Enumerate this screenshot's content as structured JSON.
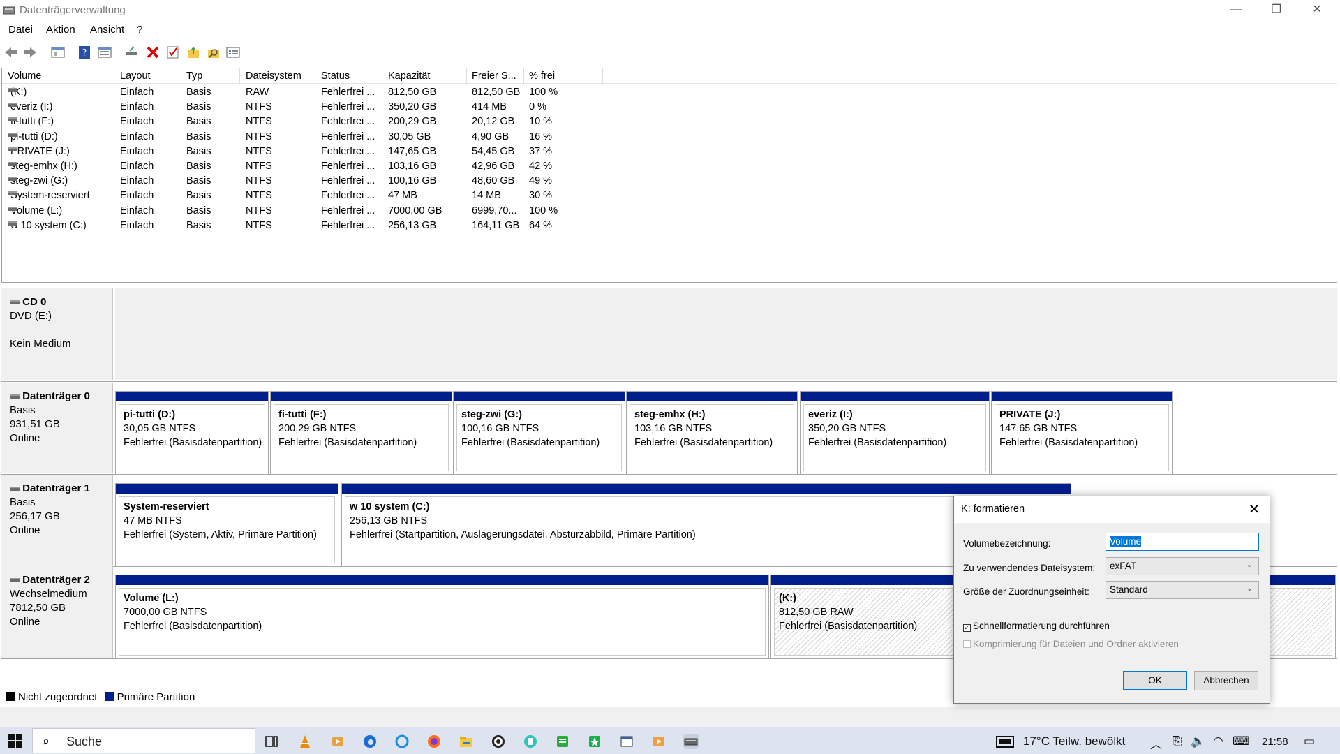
{
  "window": {
    "title": "Datenträgerverwaltung",
    "minimize": "—",
    "maximize": "❐",
    "close": "✕"
  },
  "menu": [
    "Datei",
    "Aktion",
    "Ansicht",
    "?"
  ],
  "volume_table": {
    "columns": [
      "Volume",
      "Layout",
      "Typ",
      "Dateisystem",
      "Status",
      "Kapazität",
      "Freier S...",
      "% frei"
    ],
    "rows": [
      [
        "(K:)",
        "Einfach",
        "Basis",
        "RAW",
        "Fehlerfrei ...",
        "812,50 GB",
        "812,50 GB",
        "100 %"
      ],
      [
        "everiz (I:)",
        "Einfach",
        "Basis",
        "NTFS",
        "Fehlerfrei ...",
        "350,20 GB",
        "414 MB",
        "0 %"
      ],
      [
        "fi-tutti (F:)",
        "Einfach",
        "Basis",
        "NTFS",
        "Fehlerfrei ...",
        "200,29 GB",
        "20,12 GB",
        "10 %"
      ],
      [
        "pi-tutti (D:)",
        "Einfach",
        "Basis",
        "NTFS",
        "Fehlerfrei ...",
        "30,05 GB",
        "4,90 GB",
        "16 %"
      ],
      [
        "PRIVATE (J:)",
        "Einfach",
        "Basis",
        "NTFS",
        "Fehlerfrei ...",
        "147,65 GB",
        "54,45 GB",
        "37 %"
      ],
      [
        "steg-emhx (H:)",
        "Einfach",
        "Basis",
        "NTFS",
        "Fehlerfrei ...",
        "103,16 GB",
        "42,96 GB",
        "42 %"
      ],
      [
        "steg-zwi (G:)",
        "Einfach",
        "Basis",
        "NTFS",
        "Fehlerfrei ...",
        "100,16 GB",
        "48,60 GB",
        "49 %"
      ],
      [
        "System-reserviert",
        "Einfach",
        "Basis",
        "NTFS",
        "Fehlerfrei ...",
        "47 MB",
        "14 MB",
        "30 %"
      ],
      [
        "Volume (L:)",
        "Einfach",
        "Basis",
        "NTFS",
        "Fehlerfrei ...",
        "7000,00 GB",
        "6999,70...",
        "100 %"
      ],
      [
        "w 10 system (C:)",
        "Einfach",
        "Basis",
        "NTFS",
        "Fehlerfrei ...",
        "256,13 GB",
        "164,11 GB",
        "64 %"
      ]
    ]
  },
  "disks": [
    {
      "name": "CD 0",
      "line1": "DVD (E:)",
      "line2": "",
      "line3": "Kein Medium",
      "partitions": []
    },
    {
      "name": "Datenträger 0",
      "line1": "Basis",
      "line2": "931,51 GB",
      "line3": "Online",
      "partitions": [
        {
          "name": "pi-tutti  (D:)",
          "size": "30,05 GB NTFS",
          "status": "Fehlerfrei (Basisdatenpartition)"
        },
        {
          "name": "fi-tutti  (F:)",
          "size": "200,29 GB NTFS",
          "status": "Fehlerfrei (Basisdatenpartition)"
        },
        {
          "name": "steg-zwi  (G:)",
          "size": "100,16 GB NTFS",
          "status": "Fehlerfrei (Basisdatenpartition)"
        },
        {
          "name": "steg-emhx  (H:)",
          "size": "103,16 GB NTFS",
          "status": "Fehlerfrei (Basisdatenpartition)"
        },
        {
          "name": "everiz  (I:)",
          "size": "350,20 GB NTFS",
          "status": "Fehlerfrei (Basisdatenpartition)"
        },
        {
          "name": "PRIVATE  (J:)",
          "size": "147,65 GB NTFS",
          "status": "Fehlerfrei (Basisdatenpartition)"
        }
      ]
    },
    {
      "name": "Datenträger 1",
      "line1": "Basis",
      "line2": "256,17 GB",
      "line3": "Online",
      "partitions": [
        {
          "name": "System-reserviert",
          "size": "47 MB NTFS",
          "status": "Fehlerfrei (System, Aktiv, Primäre Partition)"
        },
        {
          "name": "w 10 system  (C:)",
          "size": "256,13 GB NTFS",
          "status": "Fehlerfrei (Startpartition, Auslagerungsdatei, Absturzabbild, Primäre Partition)"
        }
      ]
    },
    {
      "name": "Datenträger 2",
      "line1": "Wechselmedium",
      "line2": "7812,50 GB",
      "line3": "Online",
      "partitions": [
        {
          "name": "Volume  (L:)",
          "size": "7000,00 GB NTFS",
          "status": "Fehlerfrei (Basisdatenpartition)"
        },
        {
          "name": "(K:)",
          "size": "812,50 GB RAW",
          "status": "Fehlerfrei (Basisdatenpartition)"
        }
      ]
    }
  ],
  "legend": {
    "unallocated": "Nicht zugeordnet",
    "primary": "Primäre Partition",
    "unallocated_color": "#000000",
    "primary_color": "#001e8c"
  },
  "dialog": {
    "title": "K: formatieren",
    "label_volume": "Volumebezeichnung:",
    "volume_value": "Volume",
    "label_fs": "Zu verwendendes Dateisystem:",
    "fs_value": "exFAT",
    "label_alloc": "Größe der Zuordnungseinheit:",
    "alloc_value": "Standard",
    "quick_format": "Schnellformatierung durchführen",
    "compression": "Komprimierung für Dateien und Ordner aktivieren",
    "ok": "OK",
    "cancel": "Abbrechen"
  },
  "taskbar": {
    "search_placeholder": "Suche",
    "weather": "17°C  Teilw. bewölkt",
    "time": "21:58"
  }
}
